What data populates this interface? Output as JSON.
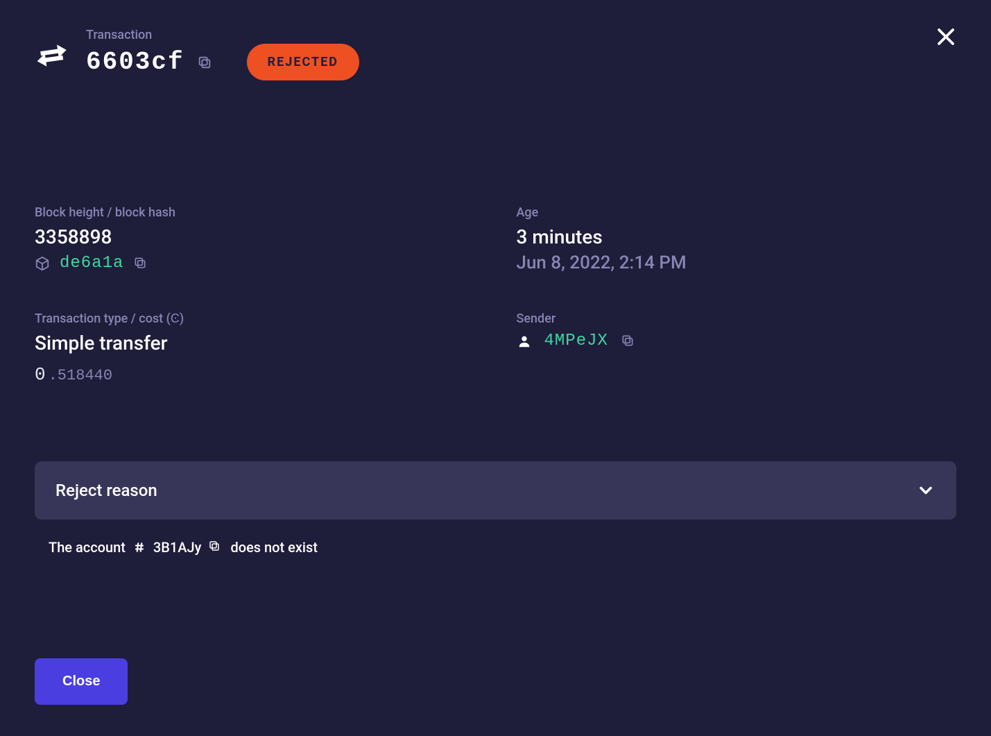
{
  "header": {
    "subtitle": "Transaction",
    "tx_hash_short": "6603cf",
    "status": "REJECTED"
  },
  "details": {
    "block_label": "Block height / block hash",
    "block_height": "3358898",
    "block_hash_short": "de6a1a",
    "age_label": "Age",
    "age_relative": "3 minutes",
    "age_timestamp": "Jun 8, 2022, 2:14 PM",
    "type_label": "Transaction type / cost (Ͼ)",
    "type_value": "Simple transfer",
    "cost_int": "0",
    "cost_dec": ".518440",
    "sender_label": "Sender",
    "sender_short": "4MPeJX"
  },
  "reject": {
    "panel_title": "Reject reason",
    "msg_prefix": "The account",
    "account_short": "3B1AJy",
    "msg_suffix": "does not exist"
  },
  "footer": {
    "close_label": "Close"
  }
}
